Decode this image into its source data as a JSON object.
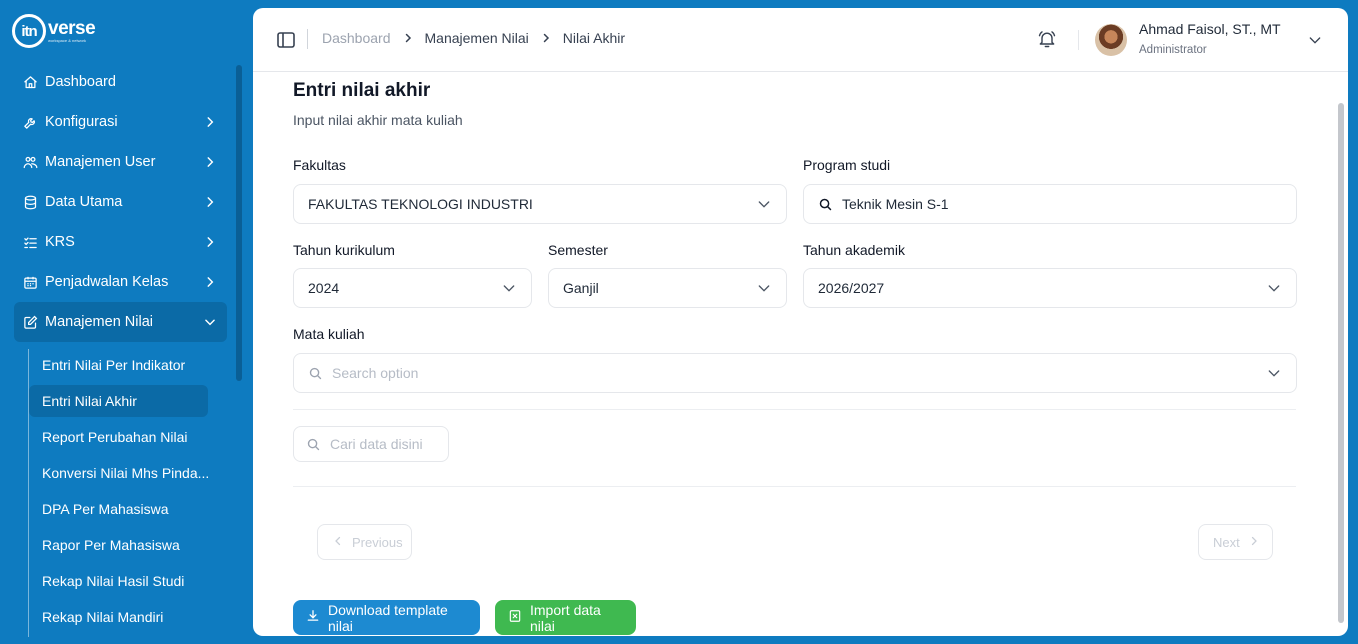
{
  "brand": {
    "logo_mark": "itn",
    "logo_word": "verse",
    "logo_sub": "workspace & network"
  },
  "sidebar": {
    "items": [
      {
        "label": "Dashboard",
        "icon": "home-icon"
      },
      {
        "label": "Konfigurasi",
        "icon": "wrench-icon"
      },
      {
        "label": "Manajemen User",
        "icon": "users-icon"
      },
      {
        "label": "Data Utama",
        "icon": "database-icon"
      },
      {
        "label": "KRS",
        "icon": "list-check-icon"
      },
      {
        "label": "Penjadwalan Kelas",
        "icon": "calendar-icon"
      },
      {
        "label": "Manajemen Nilai",
        "icon": "edit-icon"
      }
    ],
    "subitems": [
      "Entri Nilai Per Indikator",
      "Entri Nilai Akhir",
      "Report Perubahan Nilai",
      "Konversi Nilai Mhs Pinda...",
      "DPA Per Mahasiswa",
      "Rapor Per Mahasiswa",
      "Rekap Nilai Hasil Studi",
      "Rekap Nilai Mandiri"
    ]
  },
  "breadcrumb": {
    "home": "Dashboard",
    "section": "Manajemen Nilai",
    "current": "Nilai Akhir"
  },
  "user": {
    "name": "Ahmad Faisol, ST., MT",
    "role": "Administrator"
  },
  "page": {
    "title": "Entri nilai akhir",
    "subtitle": "Input nilai akhir mata kuliah"
  },
  "form": {
    "fakultas": {
      "label": "Fakultas",
      "value": "FAKULTAS TEKNOLOGI INDUSTRI"
    },
    "prodi": {
      "label": "Program studi",
      "value": "Teknik Mesin S-1"
    },
    "kurikulum": {
      "label": "Tahun kurikulum",
      "value": "2024"
    },
    "semester": {
      "label": "Semester",
      "value": "Ganjil"
    },
    "akademik": {
      "label": "Tahun akademik",
      "value": "2026/2027"
    },
    "matakuliah": {
      "label": "Mata kuliah",
      "placeholder": "Search option"
    }
  },
  "table": {
    "search_placeholder": "Cari data disini"
  },
  "pagination": {
    "previous": "Previous",
    "next": "Next"
  },
  "actions": {
    "download": "Download template nilai",
    "import": "Import data nilai"
  },
  "colors": {
    "sidebar": "#0e7bc0",
    "primary_button": "#1d8ad1",
    "success_button": "#3fb950"
  }
}
